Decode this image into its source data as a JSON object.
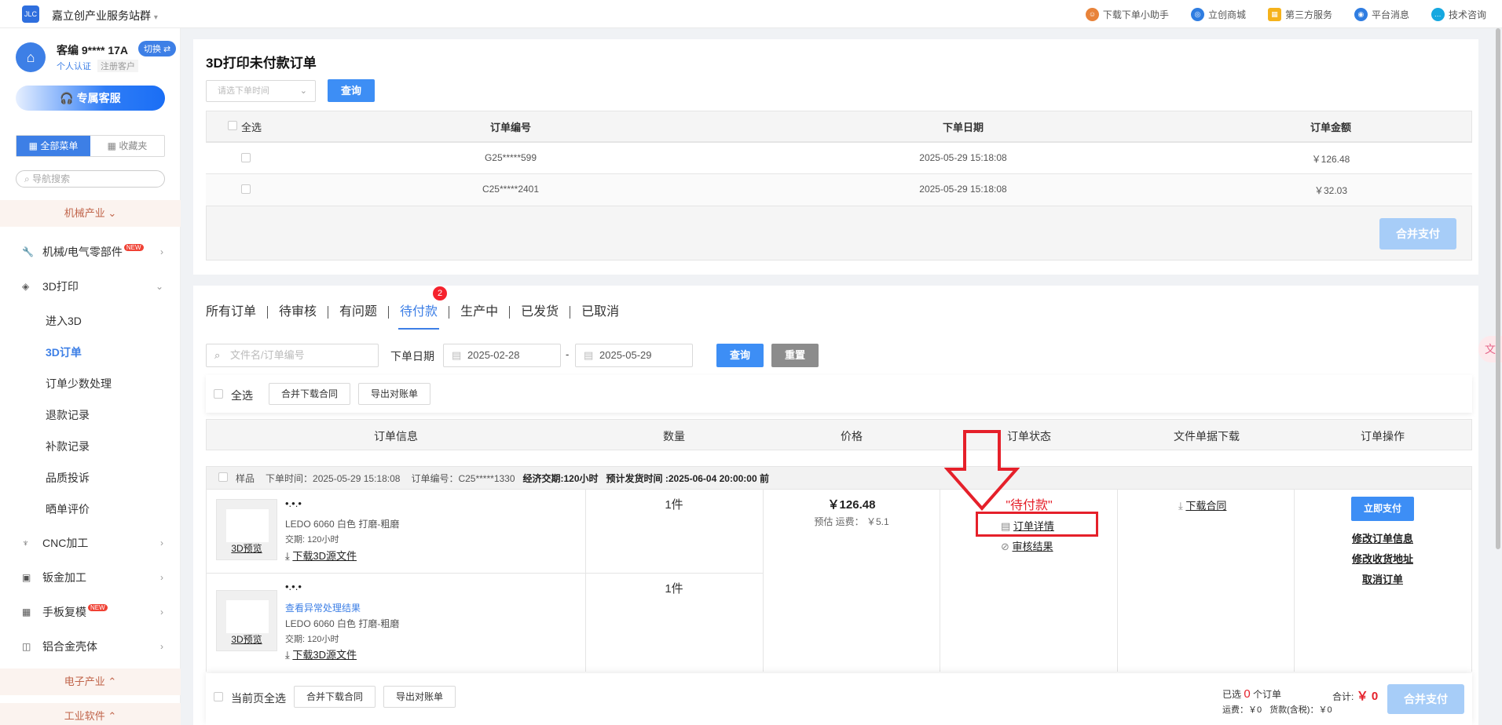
{
  "topbar": {
    "org_name": "嘉立创产业服务站群",
    "links": [
      {
        "label": "下载下单小助手",
        "icon": "assistant-icon",
        "color": "#e8833a"
      },
      {
        "label": "立创商城",
        "icon": "mall-icon",
        "color": "#2f7de1"
      },
      {
        "label": "第三方服务",
        "icon": "services-icon",
        "color": "#f5b21b"
      },
      {
        "label": "平台消息",
        "icon": "bell-icon",
        "color": "#2f7de1"
      },
      {
        "label": "技术咨询",
        "icon": "chat-icon",
        "color": "#16a8e0"
      }
    ]
  },
  "user": {
    "name": "客编 9**** 17A",
    "switch_label": "切换",
    "tag_personal": "个人认证",
    "tag_registered": "注册客户",
    "service_button": "专属客服"
  },
  "menu": {
    "tab_all": "全部菜单",
    "tab_fav": "收藏夹",
    "search_placeholder": "导航搜索",
    "section_mech": "机械产业",
    "section_elec": "电子产业",
    "section_soft": "工业软件",
    "items": {
      "parts": "机械/电气零部件",
      "print3d": "3D打印",
      "cnc": "CNC加工",
      "sheet": "钣金加工",
      "proto": "手板复模",
      "alu": "铝合金壳体"
    },
    "new_badge": "NEW",
    "sub": {
      "enter3d": "进入3D",
      "order3d": "3D订单",
      "few": "订单少数处理",
      "refund": "退款记录",
      "supplement": "补款记录",
      "complaint": "品质投诉",
      "review": "晒单评价"
    }
  },
  "unpaid": {
    "title": "3D打印未付款订单",
    "select_placeholder": "请选下单时间",
    "query_button": "查询",
    "headers": {
      "select_all": "全选",
      "order_no": "订单编号",
      "date": "下单日期",
      "amount": "订单金额"
    },
    "rows": [
      {
        "order_no": "G25*****599",
        "date": "2025-05-29 15:18:08",
        "amount": "￥126.48"
      },
      {
        "order_no": "C25*****2401",
        "date": "2025-05-29 15:18:08",
        "amount": "￥32.03"
      }
    ],
    "merge_pay": "合并支付"
  },
  "orders": {
    "tabs": [
      "所有订单",
      "待审核",
      "有问题",
      "待付款",
      "生产中",
      "已发货",
      "已取消"
    ],
    "tab_badge": "2",
    "search_placeholder": "文件名/订单编号",
    "date_label": "下单日期",
    "date_from": "2025-02-28",
    "date_to": "2025-05-29",
    "date_sep": "-",
    "query": "查询",
    "reset": "重置",
    "select_all": "全选",
    "merge_download": "合并下载合同",
    "export_bill": "导出对账单",
    "headers": [
      "订单信息",
      "数量",
      "价格",
      "订单状态",
      "文件单据下载",
      "订单操作"
    ],
    "group": {
      "sample": "样品",
      "time": "下单时间：2025-05-29 15:18:08",
      "order_no": "订单编号：C25*****1330",
      "delivery": "经济交期:120小时",
      "ship": "预计发货时间 :2025-06-04 20:00:00 前"
    },
    "items": [
      {
        "name": "•.•.•",
        "material": "LEDO 6060  白色 打磨-粗磨",
        "lead": "交期: 120小时",
        "download": "下载3D源文件",
        "preview": "3D预览",
        "qty": "1件"
      },
      {
        "name": "•.•.•",
        "abnormal": "查看异常处理结果",
        "material": "LEDO 6060  白色 打磨-粗磨",
        "lead": "交期: 120小时",
        "download": "下载3D源文件",
        "preview": "3D预览",
        "qty": "1件"
      }
    ],
    "price": "￥126.48",
    "freight": "预估 运费：  ￥5.1",
    "status": "\"待付款\"",
    "detail_link": "订单详情",
    "audit_link": "审核结果",
    "download_contract": "下载合同",
    "pay_now": "立即支付",
    "modify_info": "修改订单信息",
    "modify_address": "修改收货地址",
    "cancel": "取消订单"
  },
  "footer": {
    "page_select_all": "当前页全选",
    "merge_download": "合并下载合同",
    "export_bill": "导出对账单",
    "selected_prefix": "已选",
    "selected_count": "0",
    "selected_suffix": "个订单",
    "freight": "运费：￥0",
    "goods": "货款(含税)：￥0",
    "total_label": "合计:",
    "total_value": "￥ 0",
    "merge_pay": "合并支付"
  }
}
